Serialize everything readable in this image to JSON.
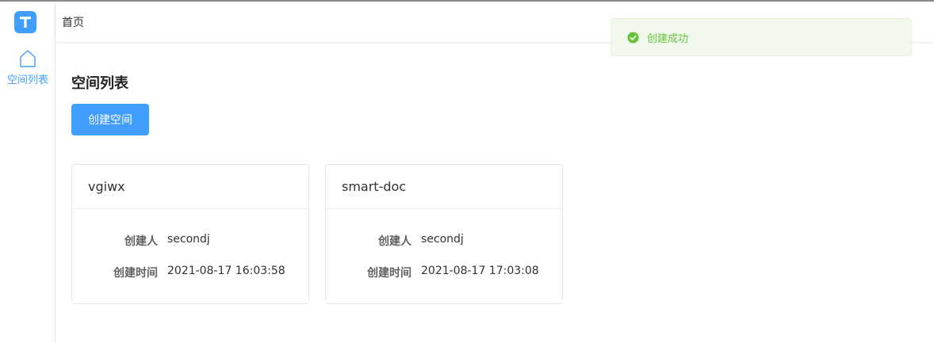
{
  "app": {
    "logo_letter": "T",
    "accent_color": "#409eff"
  },
  "sidebar": {
    "items": [
      {
        "label": "空间列表",
        "icon": "home-icon"
      }
    ]
  },
  "header": {
    "breadcrumb": "首页"
  },
  "main": {
    "title": "空间列表",
    "create_button_label": "创建空间",
    "cards": [
      {
        "name": "vgiwx",
        "creator_label": "创建人",
        "creator": "secondj",
        "created_time_label": "创建时间",
        "created_time": "2021-08-17 16:03:58"
      },
      {
        "name": "smart-doc",
        "creator_label": "创建人",
        "creator": "secondj",
        "created_time_label": "创建时间",
        "created_time": "2021-08-17 17:03:08"
      }
    ]
  },
  "toast": {
    "message": "创建成功",
    "icon": "success-check-icon",
    "color": "#67c23a"
  }
}
